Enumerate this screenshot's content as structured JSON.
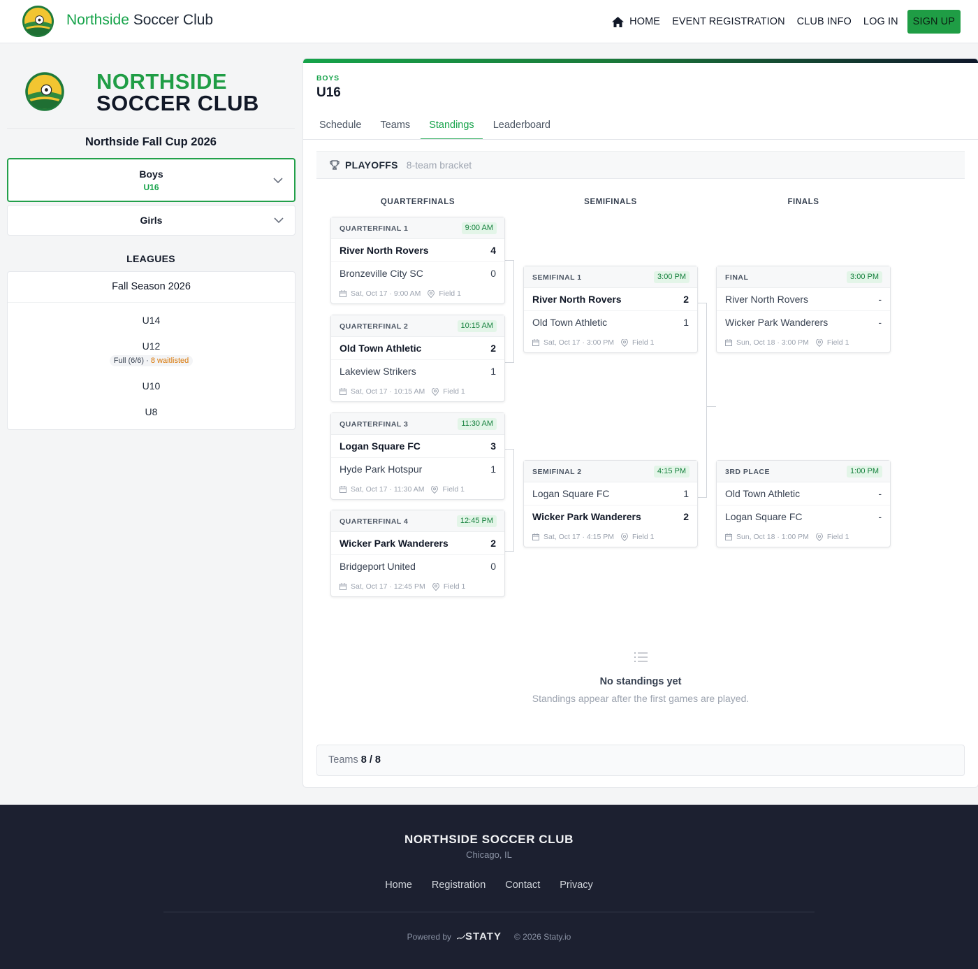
{
  "header": {
    "brand_green": "Northside",
    "brand_rest": " Soccer Club",
    "nav": {
      "home": "HOME",
      "event_registration": "EVENT REGISTRATION",
      "club_info": "CLUB INFO",
      "log_in": "LOG IN",
      "sign_up": "SIGN UP"
    }
  },
  "sidebar": {
    "club_line1": "NORTHSIDE",
    "club_line2": "SOCCER CLUB",
    "event_title": "Northside Fall Cup 2026",
    "groups": [
      {
        "title": "Boys",
        "subtitle": "U16"
      },
      {
        "title": "Girls"
      }
    ],
    "leagues_label": "LEAGUES",
    "league": {
      "season": "Fall Season 2026",
      "items": [
        "U14",
        "U12",
        "U10",
        "U8"
      ],
      "u12_status": "Full (6/6)",
      "u12_sep": " · ",
      "u12_waitlist": "8 waitlisted"
    }
  },
  "main": {
    "category": "BOYS",
    "division": "U16",
    "tabs": [
      "Schedule",
      "Teams",
      "Standings",
      "Leaderboard"
    ],
    "active_tab": "Standings",
    "playoffs_title": "PLAYOFFS",
    "playoffs_sub": "8-team bracket",
    "rounds": [
      "QUARTERFINALS",
      "SEMIFINALS",
      "FINALS"
    ],
    "matches": [
      {
        "label": "QUARTERFINAL 1",
        "time": "9:00 AM",
        "home": "River North Rovers",
        "home_score": "4",
        "away": "Bronzeville City SC",
        "away_score": "0",
        "winner": "home",
        "date": "Sat, Oct 17 · 9:00 AM",
        "field": "Field 1"
      },
      {
        "label": "QUARTERFINAL 2",
        "time": "10:15 AM",
        "home": "Old Town Athletic",
        "home_score": "2",
        "away": "Lakeview Strikers",
        "away_score": "1",
        "winner": "home",
        "date": "Sat, Oct 17 · 10:15 AM",
        "field": "Field 1"
      },
      {
        "label": "QUARTERFINAL 3",
        "time": "11:30 AM",
        "home": "Logan Square FC",
        "home_score": "3",
        "away": "Hyde Park Hotspur",
        "away_score": "1",
        "winner": "home",
        "date": "Sat, Oct 17 · 11:30 AM",
        "field": "Field 1"
      },
      {
        "label": "QUARTERFINAL 4",
        "time": "12:45 PM",
        "home": "Wicker Park Wanderers",
        "home_score": "2",
        "away": "Bridgeport United",
        "away_score": "0",
        "winner": "home",
        "date": "Sat, Oct 17 · 12:45 PM",
        "field": "Field 1"
      },
      {
        "label": "SEMIFINAL 1",
        "time": "3:00 PM",
        "home": "River North Rovers",
        "home_score": "2",
        "away": "Old Town Athletic",
        "away_score": "1",
        "winner": "home",
        "date": "Sat, Oct 17 · 3:00 PM",
        "field": "Field 1"
      },
      {
        "label": "SEMIFINAL 2",
        "time": "4:15 PM",
        "home": "Logan Square FC",
        "home_score": "1",
        "away": "Wicker Park Wanderers",
        "away_score": "2",
        "winner": "away",
        "date": "Sat, Oct 17 · 4:15 PM",
        "field": "Field 1"
      },
      {
        "label": "FINAL",
        "time": "3:00 PM",
        "home": "River North Rovers",
        "home_score": "-",
        "away": "Wicker Park Wanderers",
        "away_score": "-",
        "winner": "none",
        "date": "Sun, Oct 18 · 3:00 PM",
        "field": "Field 1"
      },
      {
        "label": "3RD PLACE",
        "time": "1:00 PM",
        "home": "Old Town Athletic",
        "home_score": "-",
        "away": "Logan Square FC",
        "away_score": "-",
        "winner": "none",
        "date": "Sun, Oct 18 · 1:00 PM",
        "field": "Field 1"
      }
    ],
    "empty_title": "No standings yet",
    "empty_sub": "Standings appear after the first games are played.",
    "teams_label": "Teams ",
    "teams_count": "8 / 8"
  },
  "footer": {
    "name": "NORTHSIDE SOCCER CLUB",
    "city": "Chicago, IL",
    "links": [
      "Home",
      "Registration",
      "Contact",
      "Privacy"
    ],
    "powered_by": "Powered by",
    "staty": "STATY",
    "copyright": "© 2026 Staty.io"
  },
  "colors": {
    "brand_green": "#16a34a",
    "footer_bg": "#1c2030",
    "waitlist": "#d97706"
  },
  "icons": [
    "club-logo",
    "home-icon",
    "chevron-down-icon",
    "trophy-icon",
    "calendar-icon",
    "location-pin-icon",
    "list-icon"
  ]
}
